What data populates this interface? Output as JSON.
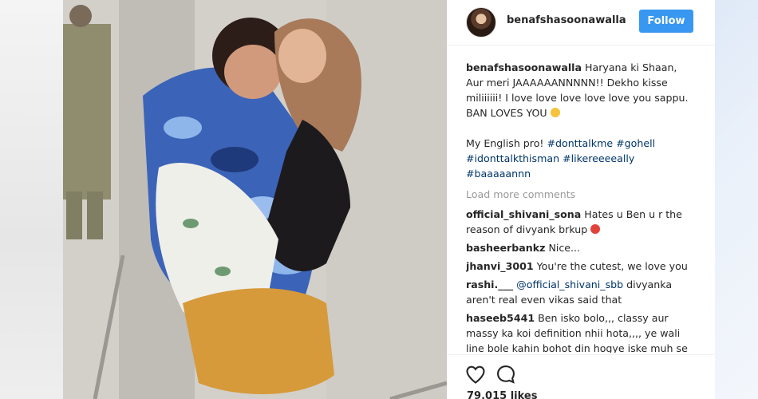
{
  "post": {
    "author": "benafshasoonawalla",
    "follow_label": "Follow",
    "caption_line1": " Haryana ki Shaan, Aur meri JAAAAAANNNNN!! Dekho kisse miliiiiii! I love love love love love you sappu. BAN LOVES YOU ",
    "caption_line2": "My English pro! ",
    "hashtags": [
      "#donttalkme",
      "#gohell",
      "#idonttalkthisman",
      "#likereeeeally",
      "#baaaaannn"
    ],
    "load_more": "Load more comments",
    "likes": "79,015 likes"
  },
  "comments": [
    {
      "user": "official_shivani_sona",
      "text": " Hates u Ben u r the reason of divyank brkup ",
      "emoji": "angry"
    },
    {
      "user": "basheerbankz",
      "text": " Nice..."
    },
    {
      "user": "jhanvi_3001",
      "text": " You're the cutest, we love you"
    },
    {
      "user": "rashi.___",
      "mention": " @official_shivani_sbb",
      "text": " divyanka aren't real even vikas said that"
    },
    {
      "user": "haseeb5441",
      "text": " Ben isko bolo,,, classy aur massy ka koi definition nhii hota,,,, ye wali line bole kahin bohot din hogye iske muh se"
    }
  ],
  "icons": {
    "like": "heart-outline-icon",
    "comment": "speech-bubble-icon",
    "caption_emoji": "grinning-face-emoji",
    "comment_emoji": "angry-face-emoji"
  },
  "colors": {
    "follow_button": "#3897f0",
    "hashtag": "#003569",
    "muted": "#999999",
    "text": "#262626"
  }
}
